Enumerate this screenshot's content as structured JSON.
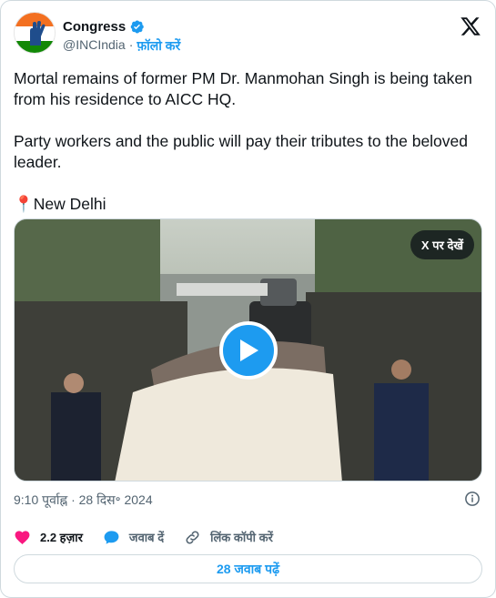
{
  "author": {
    "name": "Congress",
    "handle": "@INCIndia",
    "separator": "·",
    "follow_label": "फ़ॉलो करें",
    "verified_icon": "verified-badge-icon"
  },
  "tweet": {
    "text": "Mortal remains of former PM Dr. Manmohan Singh is being taken from his residence to AICC HQ.\n\nParty workers and the public will pay their tributes to the beloved leader.\n\n📍New Delhi"
  },
  "media": {
    "view_on_x_label": "X पर देखें",
    "play_icon": "play-icon"
  },
  "meta": {
    "timestamp": "9:10 पूर्वाह्न · 28 दिस॰ 2024"
  },
  "actions": {
    "likes": "2.2 हज़ार",
    "reply_label": "जवाब दें",
    "copy_link_label": "लिंक कॉपी करें"
  },
  "replies_button": "28 जवाब पढ़ें",
  "colors": {
    "accent": "#1d9bf0",
    "like": "#f91880",
    "text": "#0f1419",
    "muted": "#536471"
  }
}
